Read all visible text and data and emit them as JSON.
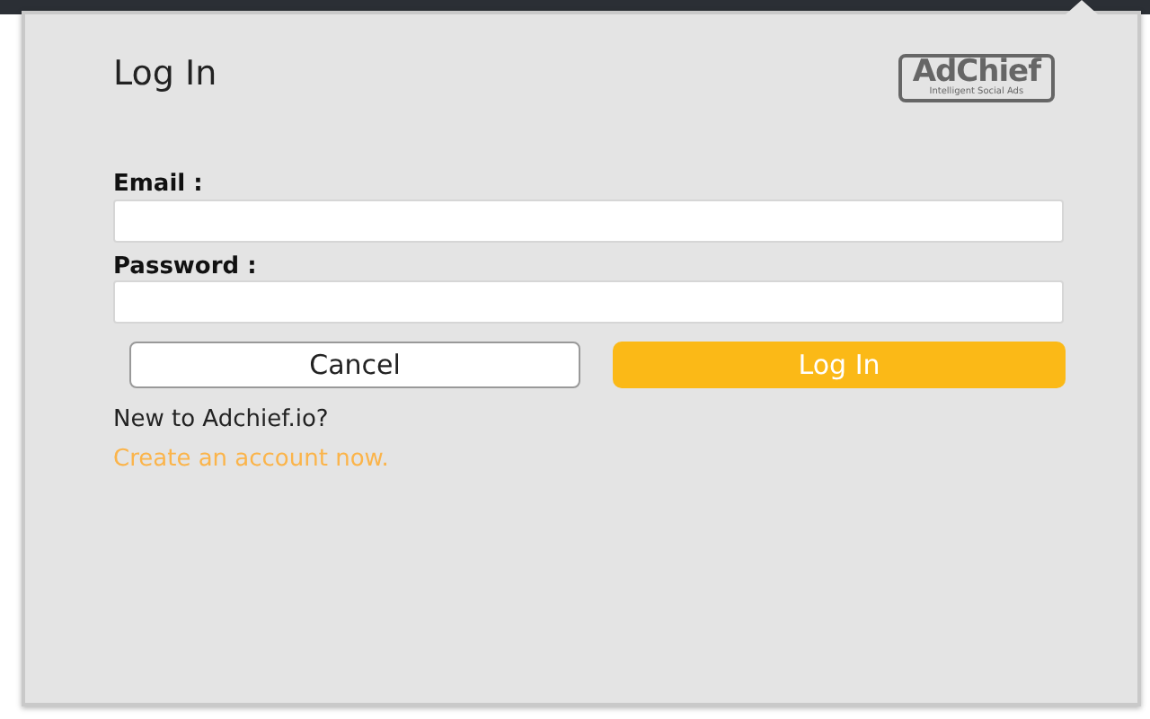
{
  "title": "Log In",
  "logo": {
    "name": "AdChief",
    "tagline": "Intelligent Social Ads"
  },
  "fields": [
    {
      "label": "Email :"
    },
    {
      "label": "Password :"
    }
  ],
  "buttons": [
    {
      "label": "Cancel",
      "kind": "secondary"
    },
    {
      "label": "Log In",
      "kind": "primary"
    }
  ],
  "signup": {
    "prompt": "New to Adchief.io?",
    "link": "Create an account now."
  }
}
